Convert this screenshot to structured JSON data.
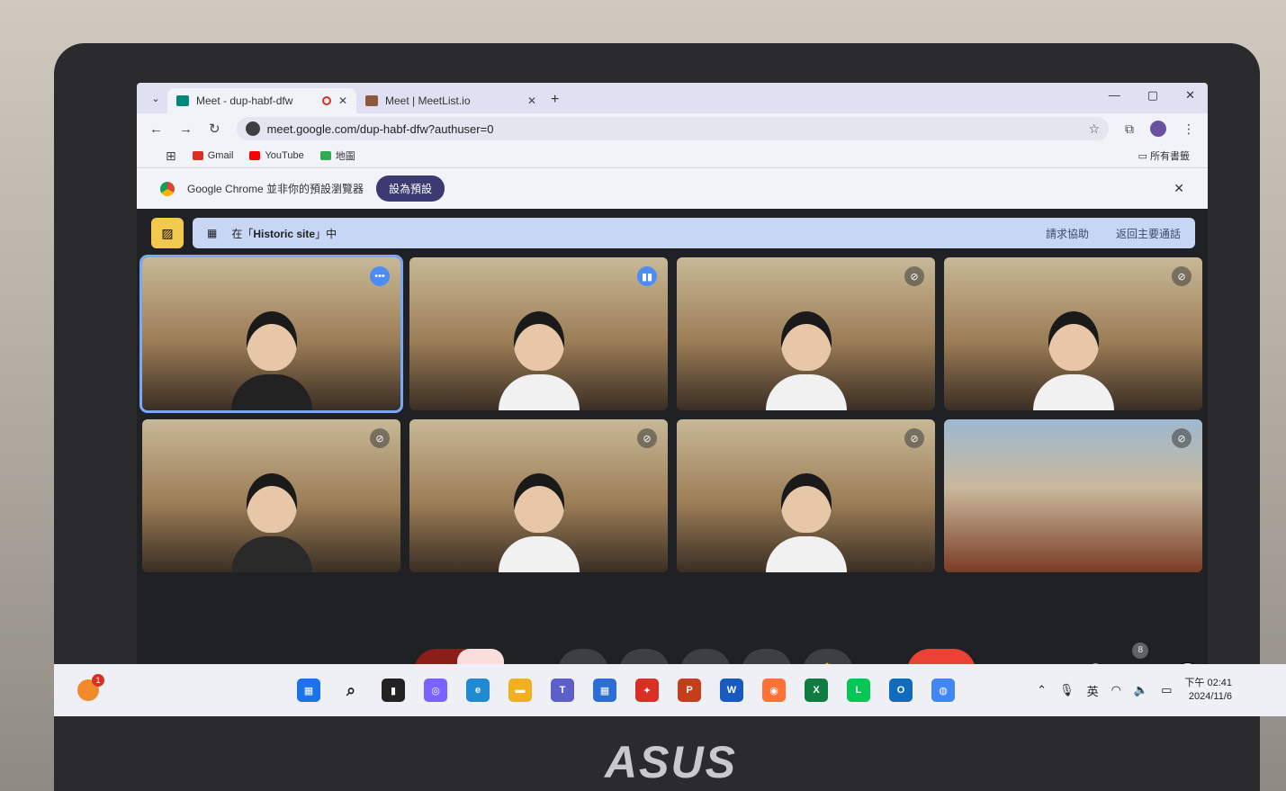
{
  "browser": {
    "tabs": [
      {
        "title": "Meet - dup-habf-dfw",
        "active": true,
        "recording": true
      },
      {
        "title": "Meet | MeetList.io",
        "active": false,
        "recording": false
      }
    ],
    "window_controls": [
      "—",
      "▢",
      "✕"
    ],
    "url": "meet.google.com/dup-habf-dfw?authuser=0",
    "bookmarks": [
      {
        "label": "Gmail",
        "color": "#d93025"
      },
      {
        "label": "YouTube",
        "color": "#ff0000"
      },
      {
        "label": "地圖",
        "color": "#34a853"
      }
    ],
    "all_bookmarks_label": "所有書籤",
    "infobar": {
      "message": "Google Chrome 並非你的預設瀏覽器",
      "button": "設為預設"
    }
  },
  "meet": {
    "breakout": {
      "prefix": "在「",
      "room": "Historic site",
      "suffix": "」中",
      "help": "請求協助",
      "return": "返回主要通話"
    },
    "tiles": [
      {
        "mic": "more",
        "active": true
      },
      {
        "mic": "speaking",
        "active": false
      },
      {
        "mic": "muted",
        "active": false
      },
      {
        "mic": "muted",
        "active": false
      },
      {
        "mic": "muted",
        "active": false
      },
      {
        "mic": "muted",
        "active": false
      },
      {
        "mic": "muted",
        "active": false
      },
      {
        "mic": "muted",
        "active": false,
        "background": "taj"
      }
    ],
    "meeting_code": "dup-habf-dfw",
    "participant_count": "8"
  },
  "taskbar": {
    "notification_count": "1",
    "ime": "英",
    "time": "下午 02:41",
    "date": "2024/11/6",
    "apps": [
      {
        "name": "windows",
        "color": "#1a73e8",
        "glyph": "▦"
      },
      {
        "name": "search",
        "color": "transparent",
        "glyph": "⌕"
      },
      {
        "name": "task-view",
        "color": "#222",
        "glyph": "▮"
      },
      {
        "name": "copilot",
        "color": "#7b61ff",
        "glyph": "◎"
      },
      {
        "name": "edge",
        "color": "#1f8ad1",
        "glyph": "e"
      },
      {
        "name": "file-explorer",
        "color": "#f2b01e",
        "glyph": "▬"
      },
      {
        "name": "teams",
        "color": "#5b5fc7",
        "glyph": "T"
      },
      {
        "name": "store",
        "color": "#2b6fd6",
        "glyph": "▦"
      },
      {
        "name": "gift",
        "color": "#d93025",
        "glyph": "✦"
      },
      {
        "name": "powerpoint",
        "color": "#c43e1c",
        "glyph": "P"
      },
      {
        "name": "word",
        "color": "#185abd",
        "glyph": "W"
      },
      {
        "name": "firefox",
        "color": "#ff7139",
        "glyph": "◉"
      },
      {
        "name": "excel",
        "color": "#107c41",
        "glyph": "X"
      },
      {
        "name": "line",
        "color": "#06c755",
        "glyph": "L"
      },
      {
        "name": "outlook",
        "color": "#0f6cbd",
        "glyph": "O"
      },
      {
        "name": "chrome",
        "color": "#4285f4",
        "glyph": "◍"
      }
    ]
  },
  "hardware": {
    "brand": "ASUS"
  }
}
